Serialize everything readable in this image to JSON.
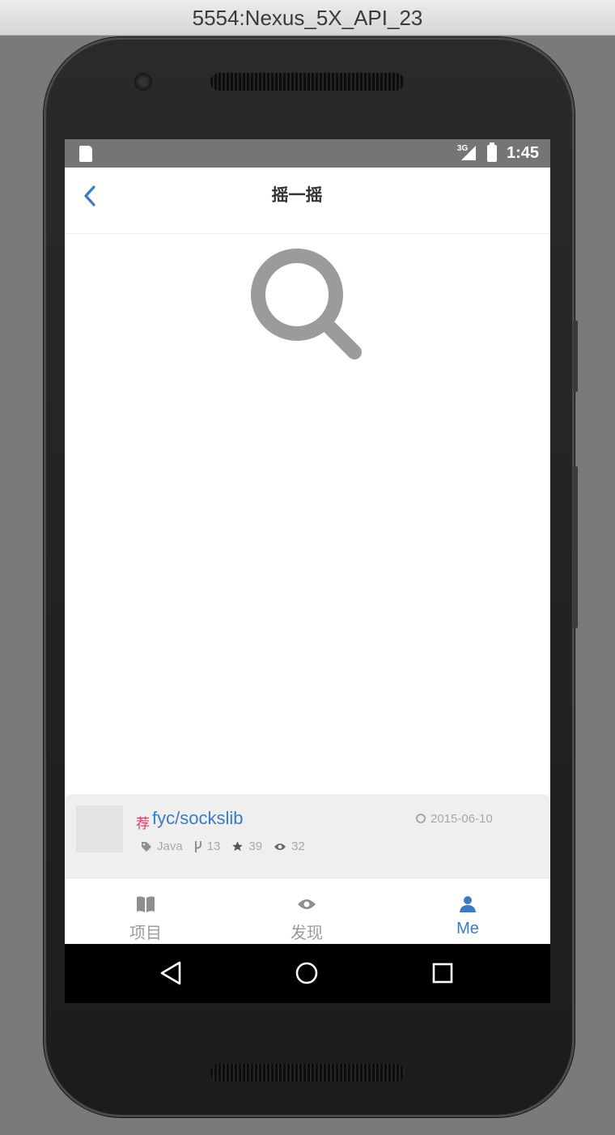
{
  "window": {
    "title": "5554:Nexus_5X_API_23"
  },
  "status_bar": {
    "network": "3G",
    "time": "1:45"
  },
  "header": {
    "title": "摇一摇"
  },
  "repo_card": {
    "badge": "荐",
    "name": "fyc/sockslib",
    "date": "2015-06-10",
    "language": "Java",
    "forks": "13",
    "stars": "39",
    "watchers": "32"
  },
  "tabs": [
    {
      "label": "项目",
      "icon": "book-icon"
    },
    {
      "label": "发现",
      "icon": "eye-icon"
    },
    {
      "label": "Me",
      "icon": "person-icon",
      "active": true
    }
  ],
  "colors": {
    "accent": "#3a7bc8",
    "badge": "#e8355a",
    "muted": "#a8a8a8",
    "status_bar": "#757575"
  },
  "system_nav": [
    "back-icon",
    "home-icon",
    "recents-icon"
  ]
}
